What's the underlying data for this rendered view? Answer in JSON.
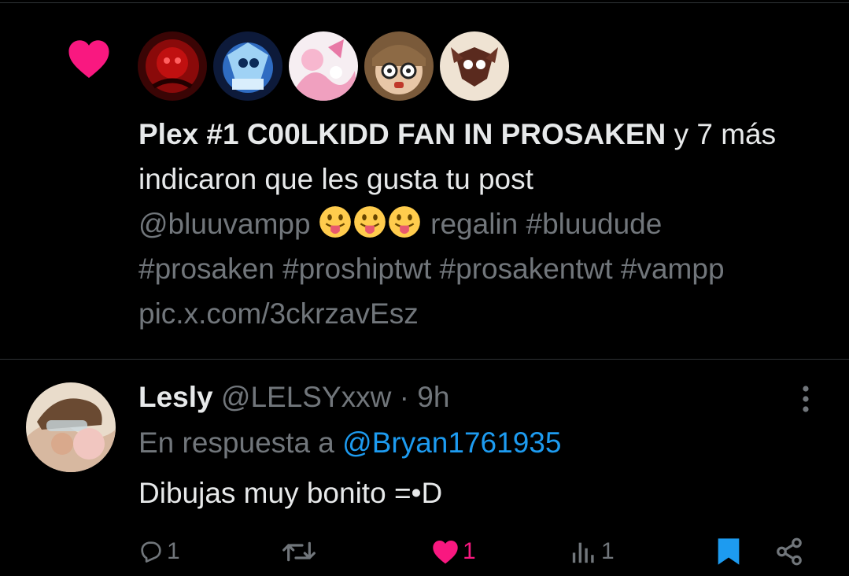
{
  "notification": {
    "liker_name": "Plex #1 C00LKIDD FAN IN PROSAKEN",
    "liker_suffix": " y 7 más indicaron que les gusta tu post",
    "preview_mention": "@bluuvampp",
    "preview_rest": " regalin #bluudude #prosaken #proshiptwt #prosakentwt #vampp pic.x.com/3ckrzavEsz",
    "icon": "heart-icon",
    "emoji": "tongue-out-face",
    "colors": {
      "like": "#f91880"
    }
  },
  "reply": {
    "display_name": "Lesly",
    "handle": "@LELSYxxw",
    "separator": "·",
    "time": "9h",
    "reply_prefix": "En respuesta a ",
    "reply_mention": "@Bryan1761935",
    "body": "Dibujas muy bonito =•D",
    "more_icon": "more-vertical-icon",
    "colors": {
      "mention": "#1d9bf0",
      "muted": "#71767b",
      "accent": "#1d9bf0"
    }
  },
  "actions": {
    "reply_count": "1",
    "retweet_count": "",
    "like_count": "1",
    "views_count": "1",
    "icons": [
      "reply-icon",
      "retweet-icon",
      "heart-icon",
      "views-icon",
      "bookmark-icon",
      "share-icon"
    ]
  }
}
